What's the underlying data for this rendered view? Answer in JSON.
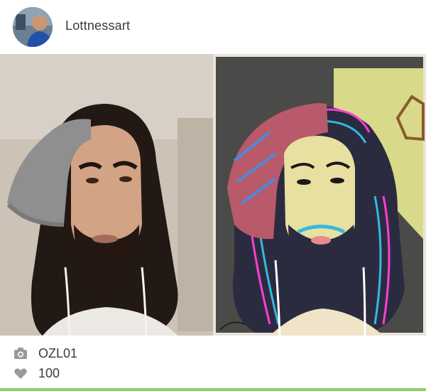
{
  "post": {
    "username": "Lottnessart",
    "camera_label": "OZL01",
    "likes": "100"
  },
  "icons": {
    "camera": "camera-icon",
    "heart": "heart-icon"
  },
  "colors": {
    "accent": "#8fcf6a",
    "icon_gray": "#9a9a9a",
    "text": "#3b3b3b"
  }
}
